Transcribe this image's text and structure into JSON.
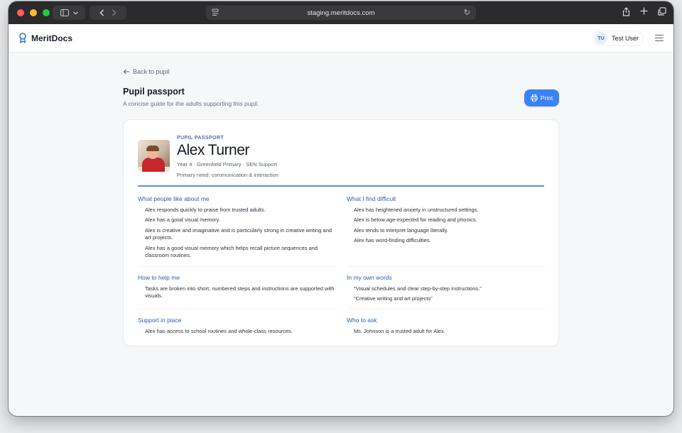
{
  "browser": {
    "url": "staging.meritdocs.com"
  },
  "app": {
    "brand": "MeritDocs",
    "user_initials": "TU",
    "user_name": "Test User"
  },
  "page": {
    "back_label": "Back to pupil",
    "title": "Pupil passport",
    "subtitle": "A concise guide for the adults supporting this pupil.",
    "print_label": "Print"
  },
  "pupil": {
    "eyebrow": "PUPIL PASSPORT",
    "name": "Alex Turner",
    "meta": "Year 4 · Greenfield Primary · SEN Support",
    "primary_need": "Primary need: communication & interaction"
  },
  "sections": {
    "likes": {
      "title": "What people like about me",
      "items": [
        "Alex responds quickly to praise from trusted adults.",
        "Alex has a good visual memory.",
        "Alex is creative and imaginative and is particularly strong in creative writing and art projects.",
        "Alex has a good visual memory which helps recall picture sequences and classroom routines."
      ]
    },
    "difficult": {
      "title": "What I find difficult",
      "items": [
        "Alex has heightened anxiety in unstructured settings.",
        "Alex is below age-expected for reading and phonics.",
        "Alex tends to interpret language literally.",
        "Alex has word-finding difficulties."
      ]
    },
    "help": {
      "title": "How to help me",
      "items": [
        "Tasks are broken into short, numbered steps and instructions are supported with visuals."
      ]
    },
    "own_words": {
      "title": "In my own words",
      "items": [
        "\"Visual schedules and clear step-by-step instructions.\"",
        "\"Creative writing and art projects\""
      ]
    },
    "support": {
      "title": "Support in place",
      "items": [
        "Alex has access to school routines and whole-class resources."
      ]
    },
    "who": {
      "title": "Who to ask",
      "items": [
        "Ms. Johnson is a trusted adult for Alex."
      ]
    }
  },
  "icons": {
    "brand": "ribbon-award-icon",
    "back": "arrow-left-icon",
    "print": "printer-icon",
    "menu": "hamburger-menu-icon"
  },
  "colors": {
    "accent": "#3b82f6",
    "section_heading": "#2c5fb8"
  }
}
